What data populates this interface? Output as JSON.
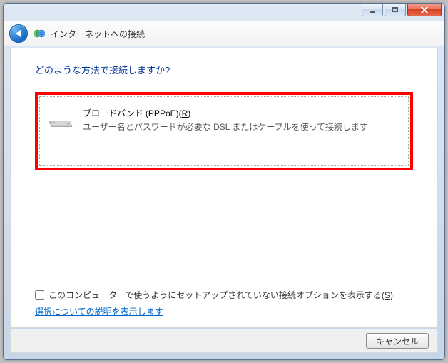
{
  "header": {
    "title": "インターネットへの接続"
  },
  "content": {
    "question": "どのような方法で接続しますか?",
    "option": {
      "title_prefix": "ブロードバンド (PPPoE)(",
      "title_accel": "R",
      "title_suffix": ")",
      "description": "ユーザー名とパスワードが必要な DSL またはケーブルを使って接続します"
    },
    "show_unconfigured_prefix": "このコンピューターで使うようにセットアップされていない接続オプションを表示する(",
    "show_unconfigured_accel": "S",
    "show_unconfigured_suffix": ")",
    "help_link": "選択についての説明を表示します"
  },
  "footer": {
    "cancel_label": "キャンセル"
  }
}
